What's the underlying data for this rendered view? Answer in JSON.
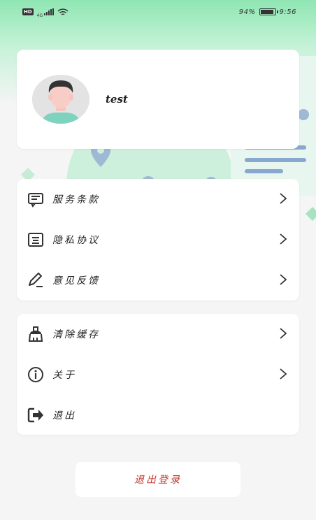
{
  "status_bar": {
    "hd": "HD",
    "network": "4G",
    "battery_percent": "94%",
    "time": "9:56",
    "battery_level": 0.94
  },
  "profile": {
    "username": "test",
    "avatar_icon": "user-avatar-icon"
  },
  "menu_group_1": {
    "items": [
      {
        "label": "服务条款",
        "icon": "terms-icon"
      },
      {
        "label": "隐私协议",
        "icon": "privacy-icon"
      },
      {
        "label": "意见反馈",
        "icon": "feedback-icon"
      }
    ]
  },
  "menu_group_2": {
    "items": [
      {
        "label": "清除缓存",
        "icon": "clear-cache-icon"
      },
      {
        "label": "关于",
        "icon": "info-icon"
      },
      {
        "label": "退出",
        "icon": "exit-icon"
      }
    ]
  },
  "logout_button": {
    "label": "退出登录"
  },
  "colors": {
    "accent_green": "#8fe6b2",
    "logout_text": "#c0392b"
  }
}
